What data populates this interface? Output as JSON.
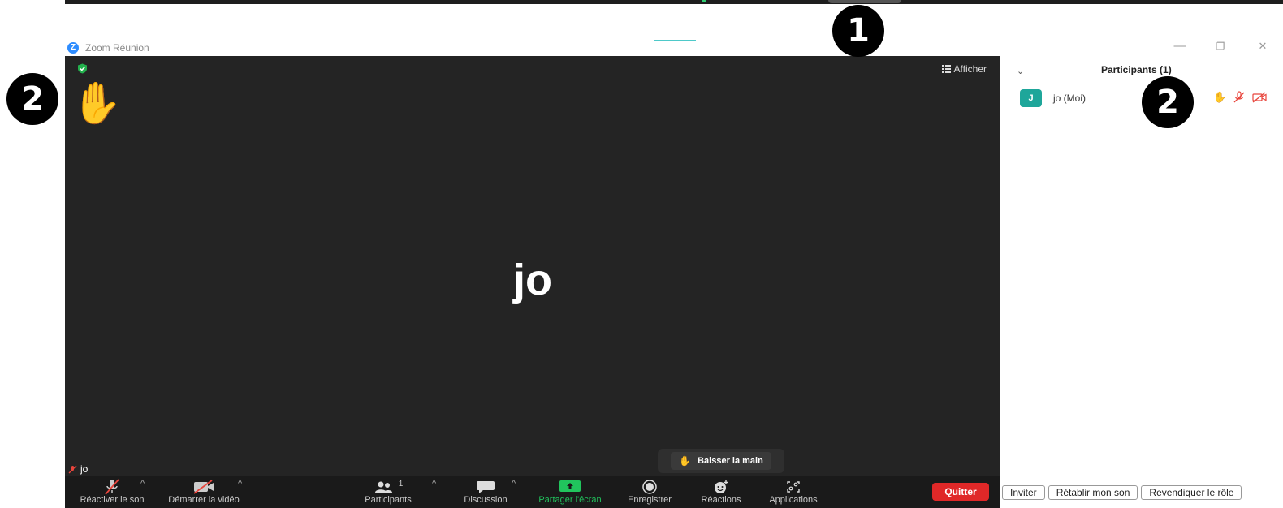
{
  "window": {
    "logo_letter": "Z",
    "title": "Zoom Réunion",
    "minimize_glyph": "—",
    "restore_glyph": "❐",
    "close_glyph": "✕"
  },
  "video": {
    "view_label": "Afficher",
    "participant_big_name": "jo",
    "name_tag": "jo",
    "lower_hand_label": "Baisser la main",
    "raised_hand_emoji": "✋"
  },
  "toolbar": {
    "unmute_label": "Réactiver le son",
    "start_video_label": "Démarrer la vidéo",
    "participants_label": "Participants",
    "participants_count": "1",
    "chat_label": "Discussion",
    "share_label": "Partager l'écran",
    "record_label": "Enregistrer",
    "reactions_label": "Réactions",
    "apps_label": "Applications",
    "quit_label": "Quitter",
    "caret": "^"
  },
  "panel": {
    "collapse_glyph": "⌄",
    "title": "Participants (1)",
    "participants": [
      {
        "initial": "J",
        "name": "jo (Moi)"
      }
    ],
    "buttons": {
      "invite": "Inviter",
      "unmute_me": "Rétablir mon son",
      "claim_host": "Revendiquer le rôle"
    }
  },
  "annotations": {
    "badge_1": "1",
    "badge_2": "2"
  },
  "colors": {
    "video_bg": "#242424",
    "toolbar_bg": "#1a1a1a",
    "share_green": "#21c45d",
    "quit_red": "#e02828",
    "avatar_teal": "#1ea69a",
    "muted_red": "#e8453c"
  }
}
